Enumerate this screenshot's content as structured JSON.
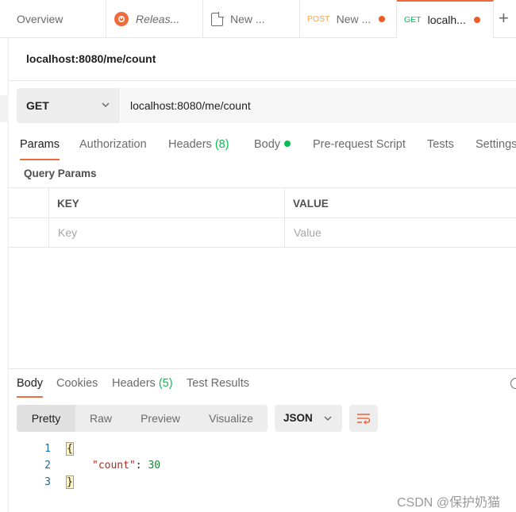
{
  "tabs": [
    {
      "label": "Overview",
      "method": "",
      "icon": "",
      "dirty": false,
      "italic": false
    },
    {
      "label": "Releas...",
      "method": "",
      "icon": "release-icon",
      "dirty": false,
      "italic": true
    },
    {
      "label": "New ...",
      "method": "",
      "icon": "document-icon",
      "dirty": false,
      "italic": false
    },
    {
      "label": "New ...",
      "method": "POST",
      "icon": "",
      "dirty": true,
      "italic": false
    },
    {
      "label": "localh...",
      "method": "GET",
      "icon": "",
      "dirty": true,
      "italic": false
    }
  ],
  "colors": {
    "accent": "#ef6b3b",
    "post": "#f0a65c",
    "get": "#0cbb52",
    "dirty_dot": "#ef5b25"
  },
  "request": {
    "title": "localhost:8080/me/count",
    "method": "GET",
    "url": "localhost:8080/me/count"
  },
  "request_tabs": [
    {
      "label": "Params",
      "active": true
    },
    {
      "label": "Authorization"
    },
    {
      "label": "Headers",
      "count": "(8)"
    },
    {
      "label": "Body",
      "dot": true
    },
    {
      "label": "Pre-request Script"
    },
    {
      "label": "Tests"
    },
    {
      "label": "Settings"
    }
  ],
  "params": {
    "section_label": "Query Params",
    "headers": [
      "KEY",
      "VALUE"
    ],
    "placeholders": {
      "key": "Key",
      "value": "Value"
    }
  },
  "response": {
    "tabs": [
      {
        "label": "Body",
        "active": true
      },
      {
        "label": "Cookies"
      },
      {
        "label": "Headers",
        "count": "(5)"
      },
      {
        "label": "Test Results"
      }
    ],
    "view_modes": [
      "Pretty",
      "Raw",
      "Preview",
      "Visualize"
    ],
    "active_view": "Pretty",
    "format": "JSON",
    "code_lines": [
      {
        "no": "1",
        "text": "{"
      },
      {
        "no": "2",
        "key": "\"count\"",
        "value": "30"
      },
      {
        "no": "3",
        "text": "}"
      }
    ]
  },
  "watermark": "CSDN @保护奶猫"
}
